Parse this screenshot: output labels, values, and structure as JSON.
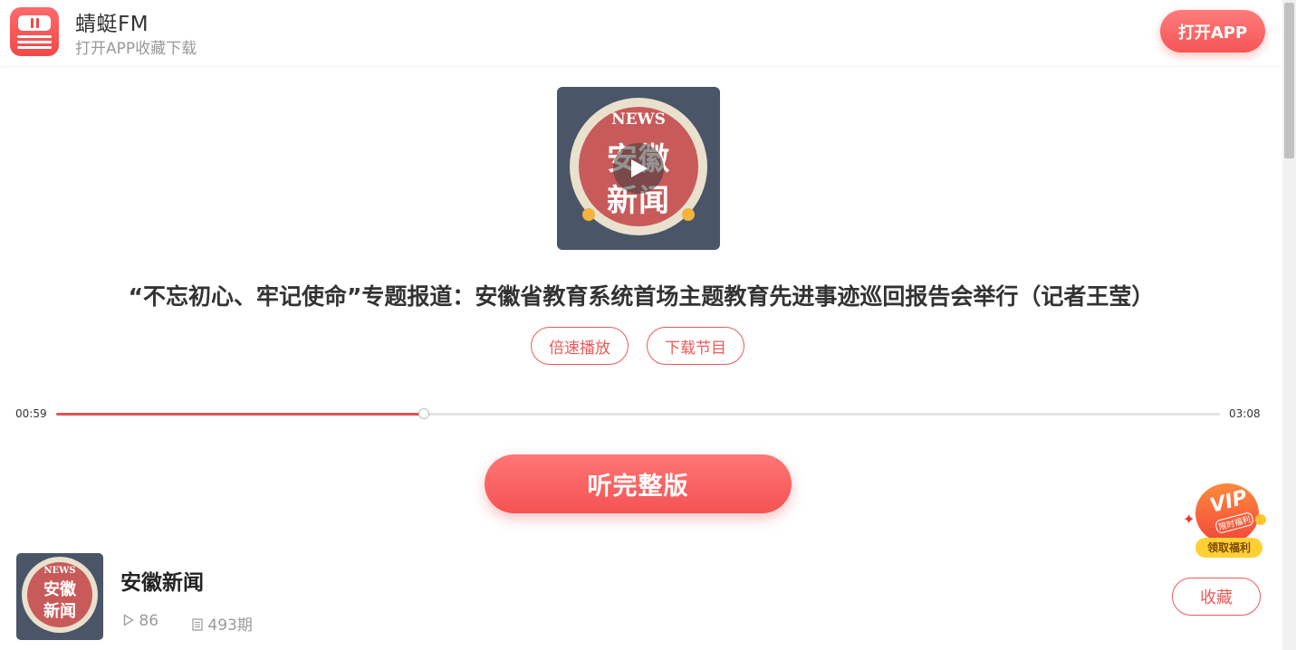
{
  "header": {
    "app_name": "蜻蜓FM",
    "subtitle": "打开APP收藏下载",
    "open_app_label": "打开APP"
  },
  "cover": {
    "news_text": "NEWS",
    "title_line1": "安徽",
    "title_line2": "新闻"
  },
  "episode": {
    "title": "“不忘初心、牢记使命”专题报道：安徽省教育系统首场主题教育先进事迹巡回报告会举行（记者王莹）",
    "speed_label": "倍速播放",
    "download_label": "下载节目"
  },
  "player": {
    "current_time": "00:59",
    "total_time": "03:08",
    "progress": 0.316
  },
  "full_version_label": "听完整版",
  "vip": {
    "badge_text": "VIP",
    "badge_sub": "限时福利",
    "label": "领取福利"
  },
  "album": {
    "name": "安徽新闻",
    "plays": "86",
    "episodes": "493期",
    "collect_label": "收藏"
  },
  "colors": {
    "accent": "#ec5a5a",
    "cover_bg": "#4a5568"
  }
}
